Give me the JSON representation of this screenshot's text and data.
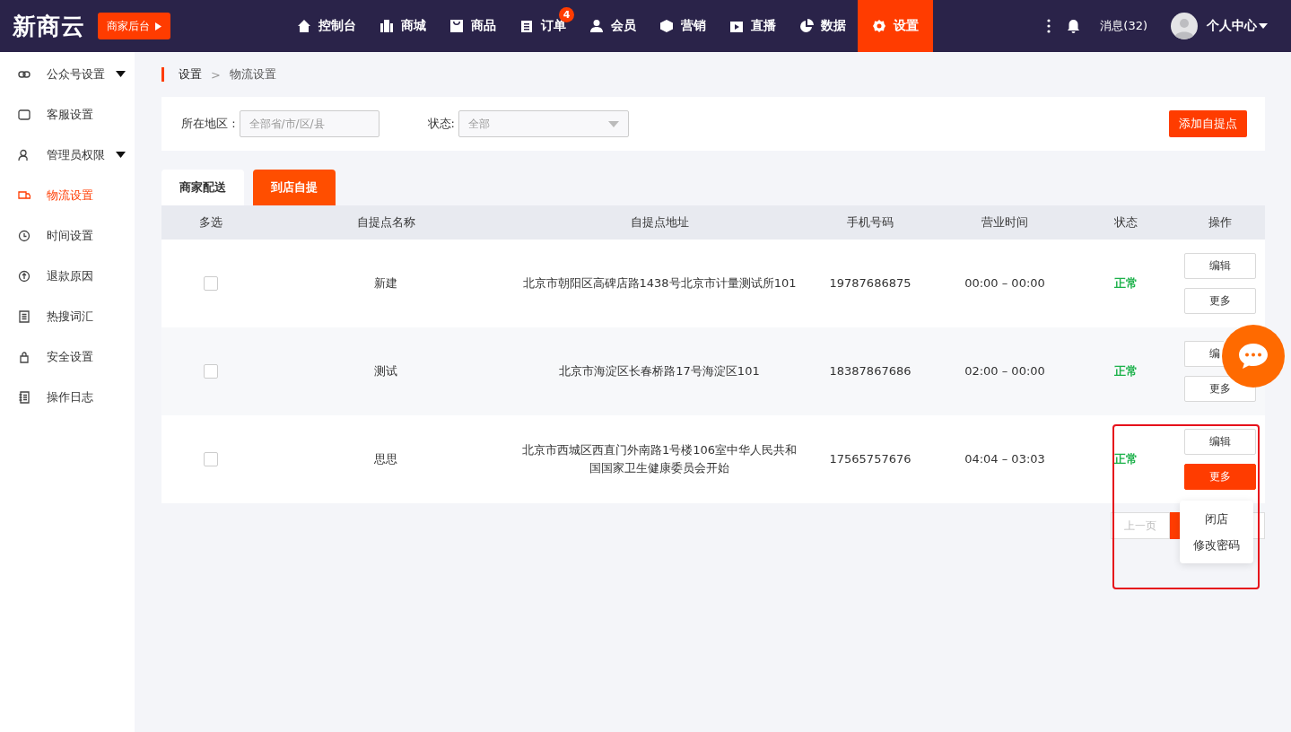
{
  "logo": "新商云",
  "backend_button": "商家后台",
  "nav": [
    {
      "label": "控制台",
      "selected": false
    },
    {
      "label": "商城",
      "selected": false
    },
    {
      "label": "商品",
      "selected": false
    },
    {
      "label": "订单",
      "selected": false,
      "badge": "4"
    },
    {
      "label": "会员",
      "selected": false
    },
    {
      "label": "营销",
      "selected": false
    },
    {
      "label": "直播",
      "selected": false
    },
    {
      "label": "数据",
      "selected": false
    },
    {
      "label": "设置",
      "selected": true
    }
  ],
  "messages": "消息(32)",
  "user_menu": "个人中心",
  "sidebar": {
    "items": [
      {
        "label": "公众号设置",
        "selected": false,
        "expandable": true
      },
      {
        "label": "客服设置",
        "selected": false,
        "expandable": false
      },
      {
        "label": "管理员权限",
        "selected": false,
        "expandable": true
      },
      {
        "label": "物流设置",
        "selected": true,
        "expandable": false
      },
      {
        "label": "时间设置",
        "selected": false,
        "expandable": false
      },
      {
        "label": "退款原因",
        "selected": false,
        "expandable": false
      },
      {
        "label": "热搜词汇",
        "selected": false,
        "expandable": false
      },
      {
        "label": "安全设置",
        "selected": false,
        "expandable": false
      },
      {
        "label": "操作日志",
        "selected": false,
        "expandable": false
      }
    ]
  },
  "breadcrumb": {
    "items": [
      "设置",
      "物流设置"
    ],
    "separator": ">"
  },
  "filters": {
    "region_label": "所在地区 :",
    "region_placeholder": "全部省/市/区/县",
    "status_label": "状态:",
    "status_value": "全部",
    "add_button": "添加自提点"
  },
  "tabs": [
    {
      "label": "商家配送",
      "selected": false
    },
    {
      "label": "到店自提",
      "selected": true
    }
  ],
  "table": {
    "columns": [
      "多选",
      "自提点名称",
      "自提点地址",
      "手机号码",
      "营业时间",
      "状态",
      "操作"
    ],
    "rows": [
      {
        "checked": false,
        "name": "新建",
        "address": "北京市朝阳区高碑店路1438号北京市计量测试所101",
        "phone": "19787686875",
        "hours": "00:00 – 00:00",
        "status": "正常",
        "actions": [
          {
            "label": "编辑",
            "selected": false
          },
          {
            "label": "更多",
            "selected": false
          }
        ]
      },
      {
        "checked": false,
        "name": "测试",
        "address": "北京市海淀区长春桥路17号海淀区101",
        "phone": "18387867686",
        "hours": "02:00 – 00:00",
        "status": "正常",
        "actions": [
          {
            "label": "编",
            "selected": false
          },
          {
            "label": "更多",
            "selected": false
          }
        ]
      },
      {
        "checked": false,
        "name": "思思",
        "address": "北京市西城区西直门外南路1号楼106室中华人民共和国国家卫生健康委员会开始",
        "phone": "17565757676",
        "hours": "04:04 – 03:03",
        "status": "正常",
        "actions": [
          {
            "label": "编辑",
            "selected": false
          },
          {
            "label": "更多",
            "selected": true
          }
        ]
      }
    ]
  },
  "pagination": {
    "prev": "上一页"
  },
  "dropdown": {
    "items": [
      "闭店",
      "修改密码"
    ]
  }
}
